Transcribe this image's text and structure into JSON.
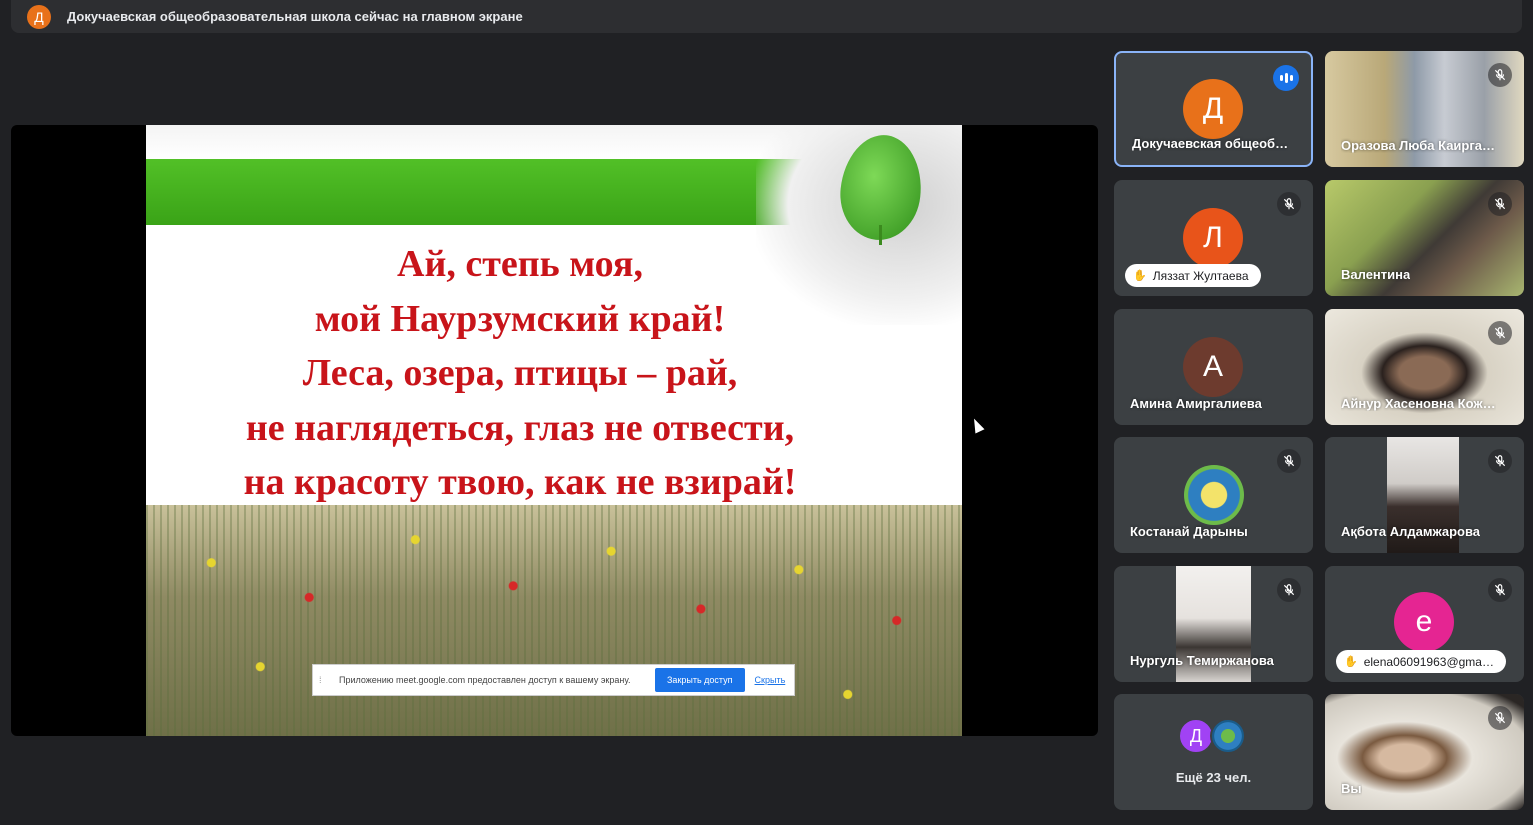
{
  "topbar": {
    "avatar_letter": "Д",
    "text": "Докучаевская общеобразовательная школа сейчас на главном экране"
  },
  "slide": {
    "lines": [
      "Ай, степь моя,",
      "мой Наурзумский край!",
      "Леса, озера, птицы – рай,",
      "не наглядеться, глаз не отвести,",
      "на красоту твою, как не взирай!"
    ],
    "share_bar": {
      "message": "Приложению meet.google.com предоставлен доступ к вашему экрану.",
      "stop_label": "Закрыть доступ",
      "hide_label": "Скрыть"
    }
  },
  "participants": [
    {
      "name": "Докучаевская общеоб…",
      "letter": "Д",
      "color": "#e8711a",
      "speaking": true
    },
    {
      "name": "Оразова Люба Каирга…",
      "video": true,
      "muted": true
    },
    {
      "name": "Ляззат Жултаева",
      "letter": "Л",
      "color": "#e8541a",
      "muted": true,
      "hand": true
    },
    {
      "name": "Валентина",
      "video": true,
      "muted": true
    },
    {
      "name": "Амина Амиргалиева",
      "letter": "А",
      "color": "#6d3b2e"
    },
    {
      "name": "Айнур Хасеновна Кож…",
      "video": true,
      "muted": true
    },
    {
      "name": "Костанай Дарыны",
      "logo": true,
      "muted": true
    },
    {
      "name": "Ақбота Алдамжарова",
      "video": true,
      "muted": true
    },
    {
      "name": "Нургуль Темиржанова",
      "video": true,
      "muted": true
    },
    {
      "name": "elena06091963@gma…",
      "letter": "е",
      "color": "#e52592",
      "muted": true,
      "hand": true
    },
    {
      "more_label": "Ещё 23 чел.",
      "letter": "Д",
      "color": "#a142f4"
    },
    {
      "name": "Вы",
      "video": true,
      "muted": true
    }
  ]
}
